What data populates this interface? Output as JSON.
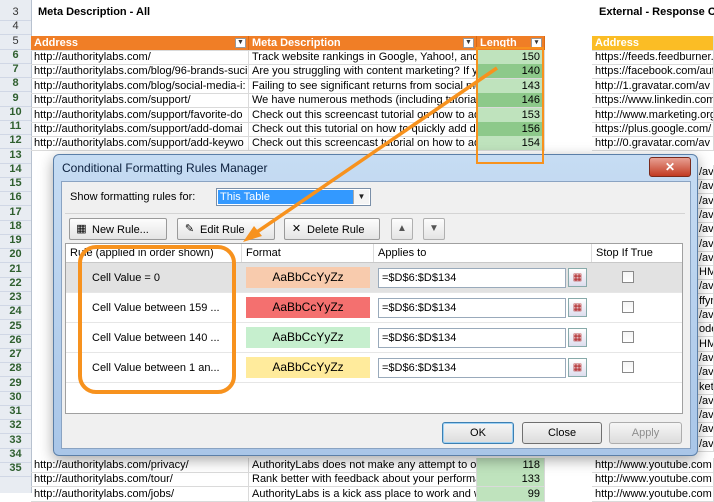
{
  "sheet": {
    "title_left": "Meta Description - All",
    "title_right": "External - Response Cod",
    "row_numbers": [
      "3",
      "4",
      "5",
      "6",
      "7",
      "8",
      "9",
      "10",
      "11",
      "12",
      "13",
      "14",
      "15",
      "16",
      "17",
      "18",
      "19",
      "20",
      "21",
      "22",
      "23",
      "24",
      "25",
      "26",
      "27",
      "28",
      "29",
      "30",
      "31",
      "32",
      "33",
      "34",
      "35"
    ],
    "headers": {
      "address": "Address",
      "meta": "Meta Description",
      "length": "Length",
      "ext_address": "Address"
    },
    "rows": [
      {
        "address": "http://authoritylabs.com/",
        "meta": "Track website rankings in Google, Yahoo!, and B",
        "length": "150",
        "ext": "https://feeds.feedburner.co"
      },
      {
        "address": "http://authoritylabs.com/blog/96-brands-suci",
        "meta": "Are you struggling with content marketing? If y",
        "length": "140",
        "ext": "https://facebook.com/aut"
      },
      {
        "address": "http://authoritylabs.com/blog/social-media-i:",
        "meta": "Failing to see significant returns from social me",
        "length": "143",
        "ext": "http://1.gravatar.com/av"
      },
      {
        "address": "http://authoritylabs.com/support/",
        "meta": "We have numerous methods (including tutorial",
        "length": "146",
        "ext": "https://www.linkedin.com"
      },
      {
        "address": "http://authoritylabs.com/support/favorite-do",
        "meta": "Check out this screencast tutorial on how to ad",
        "length": "153",
        "ext": "http://www.marketing.org"
      },
      {
        "address": "http://authoritylabs.com/support/add-domai",
        "meta": "Check out this tutorial on how to quickly add do",
        "length": "156",
        "ext": "https://plus.google.com/"
      },
      {
        "address": "http://authoritylabs.com/support/add-keywo",
        "meta": "Check out this screencast tutorial on how to add",
        "length": "154",
        "ext": "http://0.gravatar.com/av"
      }
    ],
    "ext_rows": [
      "/av",
      "/av",
      "/av",
      "/av",
      "/av",
      "/av",
      "/av",
      "HMg",
      "/av",
      "ffyr",
      "/av",
      "ode",
      "HMg",
      "/av",
      "/av",
      "ket.",
      "/av",
      "/av",
      "/av",
      "/av"
    ],
    "bottom_rows": [
      {
        "address": "http://authoritylabs.com/privacy/",
        "meta": "AuthorityLabs does not make any attempt to ob",
        "length": "118",
        "ext": "http://www.youtube.com"
      },
      {
        "address": "http://authoritylabs.com/tour/",
        "meta": "Rank better with feedback about your performa",
        "length": "133",
        "ext": "http://www.youtube.com"
      },
      {
        "address": "http://authoritylabs.com/jobs/",
        "meta": "AuthorityLabs is a kick ass place to work and w",
        "length": "99",
        "ext": "http://www.youtube.com"
      }
    ]
  },
  "dialog": {
    "title": "Conditional Formatting Rules Manager",
    "close_glyph": "✕",
    "show_label": "Show formatting rules for:",
    "show_value": "This Table",
    "toolbar": {
      "new_rule": "New Rule...",
      "edit_rule": "Edit Rule",
      "delete_rule": "Delete Rule"
    },
    "columns": {
      "rule": "Rule (applied in order shown)",
      "format": "Format",
      "applies": "Applies to",
      "stop": "Stop If True"
    },
    "rules": [
      {
        "rule": "Cell Value = 0",
        "preview": "AaBbCcYyZz",
        "bg": "#f8cbad",
        "applies": "=$D$6:$D$134",
        "stop": false
      },
      {
        "rule": "Cell Value between 159 ...",
        "preview": "AaBbCcYyZz",
        "bg": "#f4706f",
        "applies": "=$D$6:$D$134",
        "stop": false
      },
      {
        "rule": "Cell Value between 140 ...",
        "preview": "AaBbCcYyZz",
        "bg": "#c6efce",
        "applies": "=$D$6:$D$134",
        "stop": false
      },
      {
        "rule": "Cell Value between 1 an...",
        "preview": "AaBbCcYyZz",
        "bg": "#ffeb9c",
        "applies": "=$D$6:$D$134",
        "stop": false
      }
    ],
    "buttons": {
      "ok": "OK",
      "close": "Close",
      "apply": "Apply"
    }
  },
  "colors": {
    "header_orange": "#f07e26",
    "header_yellow": "#fbbd25",
    "highlight_orange": "#f7921e"
  }
}
